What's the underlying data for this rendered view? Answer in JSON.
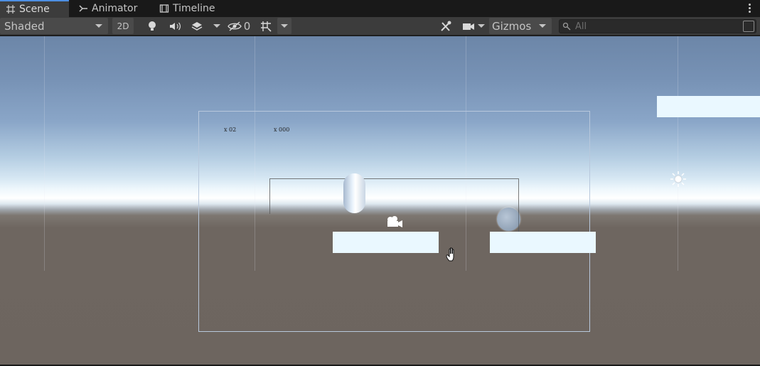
{
  "tabs": [
    {
      "label": "Scene",
      "icon": "grid-hash-icon",
      "active": true
    },
    {
      "label": "Animator",
      "icon": "animator-icon",
      "active": false
    },
    {
      "label": "Timeline",
      "icon": "timeline-film-icon",
      "active": false
    }
  ],
  "toolbar": {
    "shading_mode": "Shaded",
    "mode_2d_label": "2D",
    "hidden_count": "0",
    "gizmos_label": "Gizmos",
    "search_placeholder": "All"
  },
  "scene": {
    "hud_lives": "x 02",
    "hud_score": "x 000"
  },
  "colors": {
    "active_tab_accent": "#4d8fe3",
    "platform": "#eaf8ff",
    "camera_frame": "#b8c8dc"
  }
}
